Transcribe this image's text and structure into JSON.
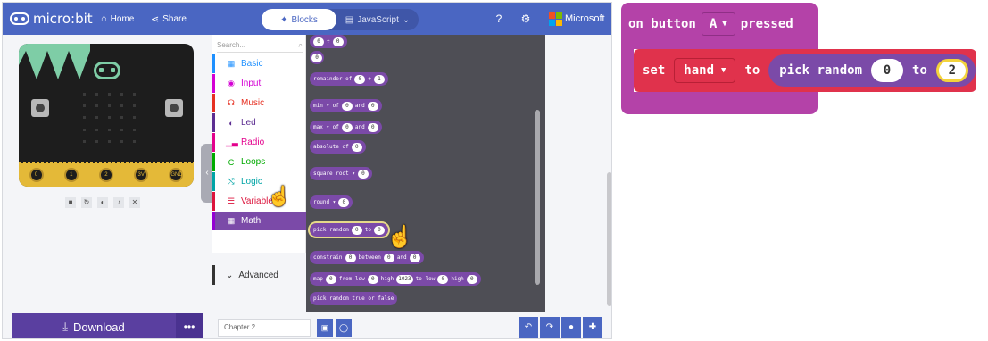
{
  "topbar": {
    "logo": "micro:bit",
    "home": "Home",
    "share": "Share",
    "mode_blocks": "Blocks",
    "mode_js": "JavaScript",
    "microsoft": "Microsoft"
  },
  "toolbox": {
    "search_placeholder": "Search...",
    "categories": [
      {
        "label": "Basic",
        "color": "#1e90ff"
      },
      {
        "label": "Input",
        "color": "#d400d4"
      },
      {
        "label": "Music",
        "color": "#e63022"
      },
      {
        "label": "Led",
        "color": "#5c2d91"
      },
      {
        "label": "Radio",
        "color": "#e3008c"
      },
      {
        "label": "Loops",
        "color": "#00aa00"
      },
      {
        "label": "Logic",
        "color": "#00a4a6"
      },
      {
        "label": "Variables",
        "color": "#dc143c"
      },
      {
        "label": "Math",
        "color": "#9400d3"
      }
    ],
    "advanced": "Advanced"
  },
  "flyout": {
    "remainder": "remainder of",
    "min": "min ▾  of",
    "max": "max ▾  of",
    "and": "and",
    "absolute": "absolute of",
    "sqrt": "square root ▾",
    "round": "round ▾",
    "pick_random": "pick random",
    "to": "to",
    "constrain": "constrain",
    "between": "between",
    "map": "map",
    "from_low": "from low",
    "high": "high",
    "to_low": "to low",
    "high_val": "1023",
    "pick_bool": "pick random true or false",
    "zero": "0",
    "one": "1"
  },
  "bottom": {
    "download": "Download",
    "project_name": "Chapter 2"
  },
  "snippet": {
    "on_button": "on button",
    "button_value": "A",
    "pressed": "pressed",
    "set": "set",
    "variable": "hand",
    "to": "to",
    "pick_random": "pick random",
    "from_value": "0",
    "to_value": "2"
  },
  "board": {
    "pin_labels": [
      "0",
      "1",
      "2",
      "3V",
      "GND"
    ]
  }
}
